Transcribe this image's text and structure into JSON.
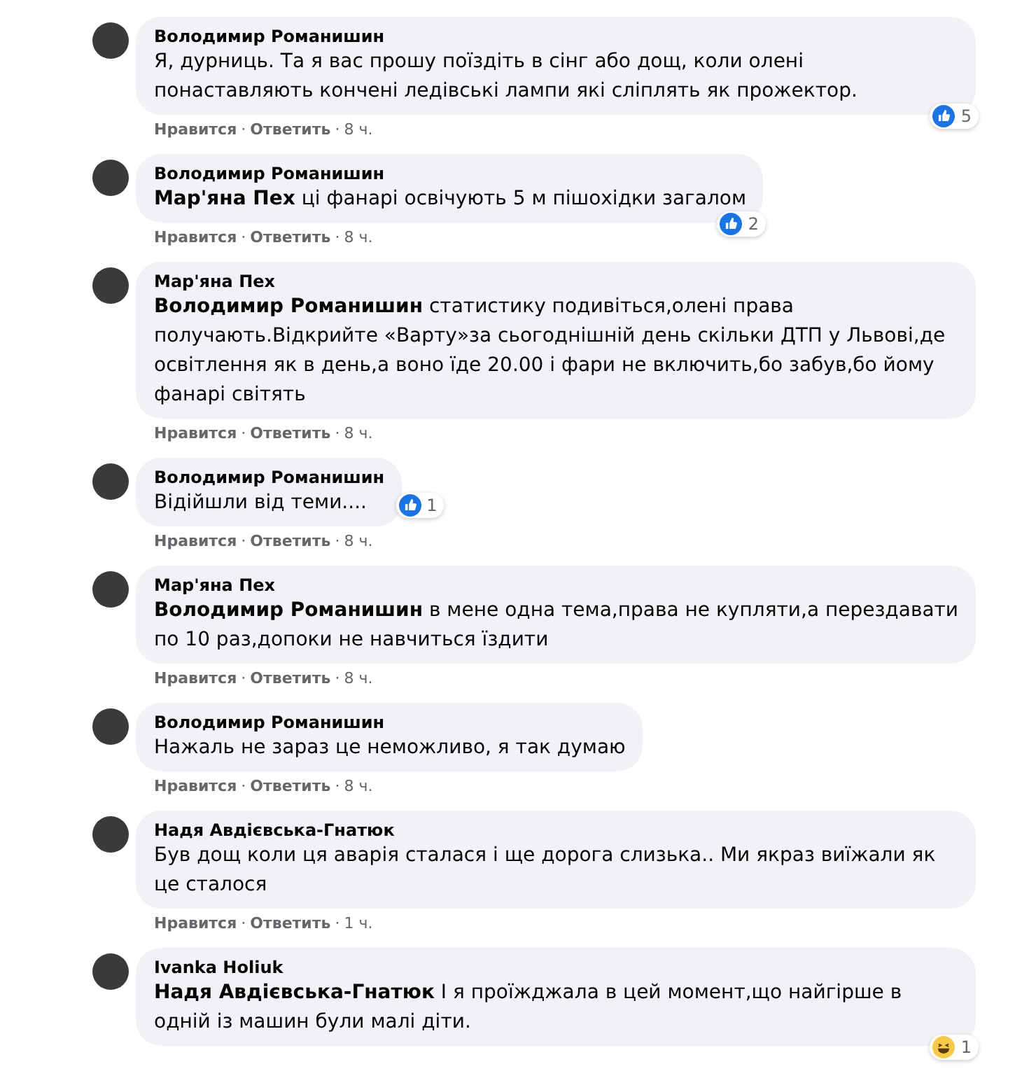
{
  "comments": [
    {
      "author": "Володимир Романишин",
      "text": "Я, дурниць. Та я вас прошу поїздіть в сінг або дощ, коли олені понаставляють кончені ледівські лампи які сліплять як прожектор.",
      "reaction": {
        "kind": "like",
        "count": "5"
      },
      "like": "Нравится",
      "reply": "Ответить",
      "time": "8 ч.",
      "separators": [
        "·",
        "·"
      ]
    },
    {
      "author": "Володимир Романишин",
      "text": "**Мар'яна Пех** ці фанарі освічують 5 м пішохідки загалом",
      "reaction": {
        "kind": "like",
        "count": "2"
      },
      "like": "Нравится",
      "reply": "Ответить",
      "time": "8 ч.",
      "separators": [
        "·",
        "·"
      ]
    },
    {
      "author": "Мар'яна Пех",
      "text": "**Володимир Романишин** статистику подивіться,олені права получають.Відкрийте «Варту»за сьогоднішній день скільки ДТП у Львові,де освітлення як в день,а воно їде 20.00 і фари не включить,бо забув,бо йому фанарі світять",
      "like": "Нравится",
      "reply": "Ответить",
      "time": "8 ч.",
      "separators": [
        "·",
        "·"
      ]
    },
    {
      "author": "Володимир Романишин",
      "text": "Відійшли від теми....",
      "reaction": {
        "kind": "like",
        "count": "1"
      },
      "like": "Нравится",
      "reply": "Ответить",
      "time": "8 ч.",
      "separators": [
        "·",
        "·"
      ]
    },
    {
      "author": "Мар'яна Пех",
      "text": "**Володимир Романишин** в мене одна тема,права не купляти,а перездавати по 10 раз,допоки не навчиться їздити",
      "like": "Нравится",
      "reply": "Ответить",
      "time": "8 ч.",
      "separators": [
        "·",
        "·"
      ]
    },
    {
      "author": "Володимир Романишин",
      "text": "Нажаль не зараз це неможливо, я так думаю",
      "like": "Нравится",
      "reply": "Ответить",
      "time": "8 ч.",
      "separators": [
        "·",
        "·"
      ]
    },
    {
      "author": "Надя Авдієвська-Гнатюк",
      "text": "Був дощ коли ця аварія сталася і ще дорога слизька.. Ми якраз виїжали як це сталося",
      "like": "Нравится",
      "reply": "Ответить",
      "time": "1 ч.",
      "separators": [
        "·",
        "·"
      ]
    },
    {
      "author": "Ivanka Holiuk",
      "text": "**Надя Авдієвська-Гнатюк** І я проїжджала в цей момент,що найгірше в одній із машин були малі діти.",
      "reaction": {
        "kind": "haha",
        "count": "1"
      }
    }
  ]
}
